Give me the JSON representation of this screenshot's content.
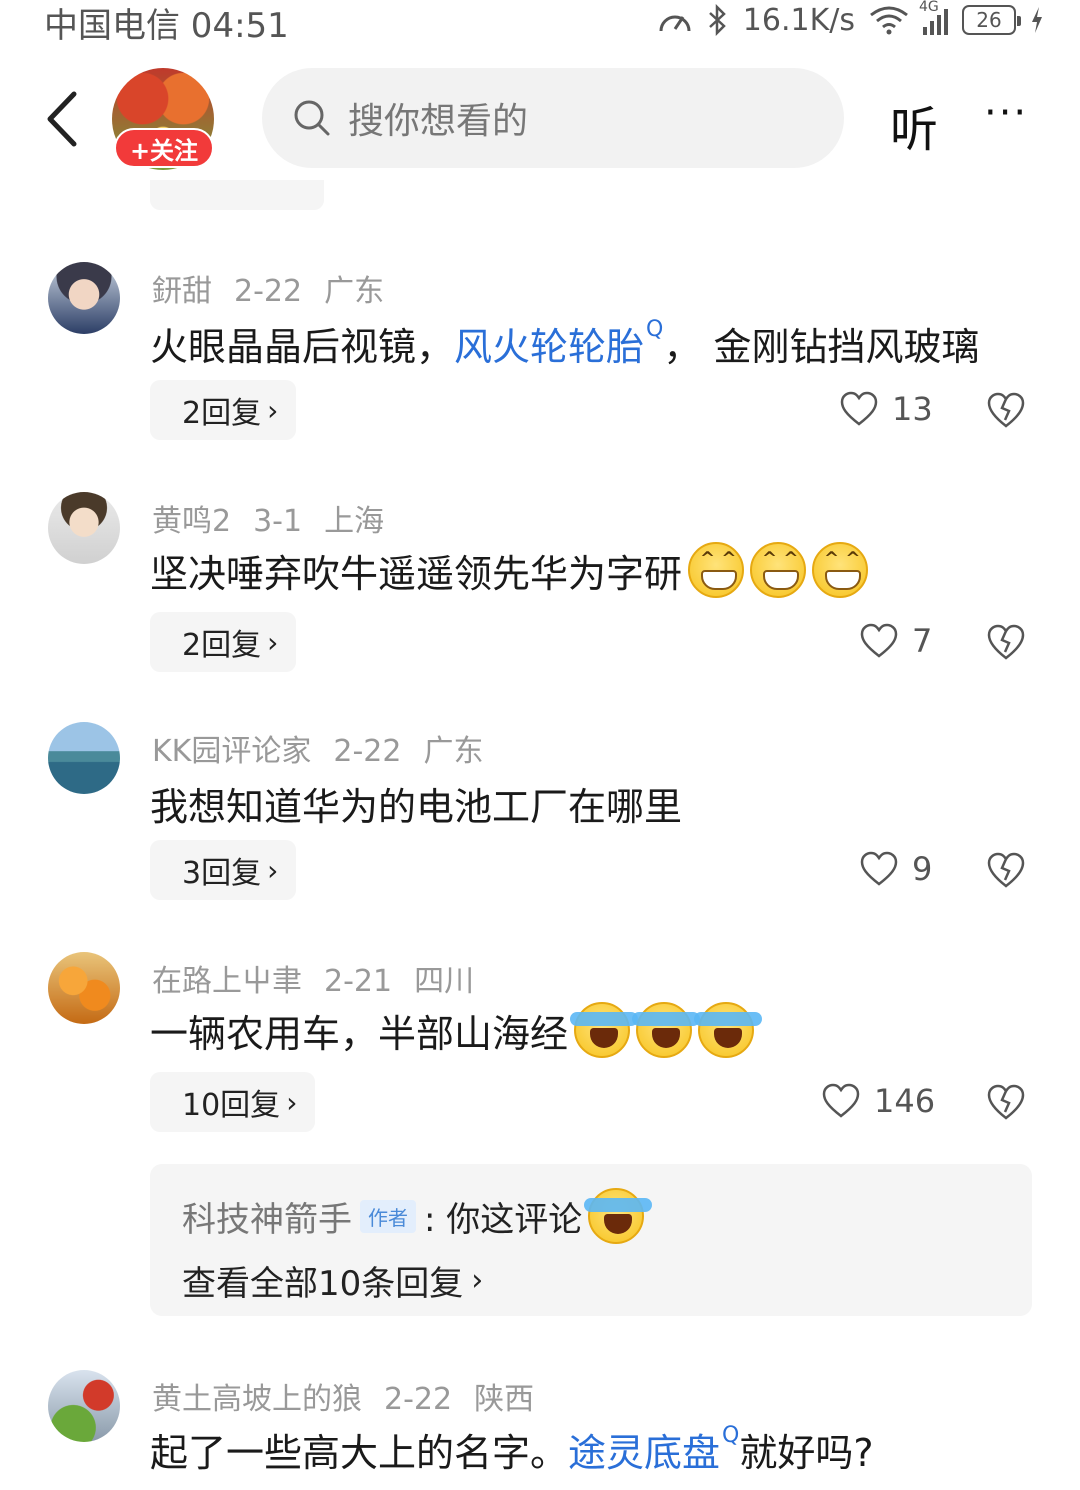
{
  "status_bar": {
    "carrier_time": "中国电信 04:51",
    "network_speed": "16.1K/s",
    "signal_label": "4G",
    "battery": "26"
  },
  "header": {
    "follow_label": "+关注",
    "search_placeholder": "搜你想看的",
    "listen_label": "听",
    "more_label": "···"
  },
  "comments": [
    {
      "user": "鈃甜",
      "date": "2-22",
      "location": "广东",
      "text_before": "火眼晶晶后视镜，",
      "link": "风火轮轮胎",
      "link_marker": "Q",
      "text_after": "， 金刚钻挡风玻璃",
      "replies": "2回复",
      "likes": "13"
    },
    {
      "user": "黄鸣2",
      "date": "3-1",
      "location": "上海",
      "text": "坚决唾弃吹牛遥遥领先华为字研",
      "emojis": [
        "grin",
        "grin",
        "grin"
      ],
      "replies": "2回复",
      "likes": "7"
    },
    {
      "user": "KK园评论家",
      "date": "2-22",
      "location": "广东",
      "text": "我想知道华为的电池工厂在哪里",
      "replies": "3回复",
      "likes": "9"
    },
    {
      "user": "在路上屮聿",
      "date": "2-21",
      "location": "四川",
      "text": "一辆农用车，半部山海经",
      "emojis": [
        "cry",
        "cry",
        "cry"
      ],
      "replies": "10回复",
      "likes": "146",
      "sub_reply": {
        "author": "科技神箭手",
        "author_tag": "作者",
        "text": ": 你这评论",
        "emojis": [
          "cry"
        ],
        "view_all": "查看全部10条回复"
      }
    },
    {
      "user": "黄土高坡上的狼",
      "date": "2-22",
      "location": "陕西",
      "text_before": "起了一些高大上的名字。",
      "link": "途灵底盘",
      "link_marker": "Q",
      "text_after": " 就好吗?"
    }
  ],
  "colors": {
    "link": "#2a6fd8",
    "follow": "#f23a3a",
    "chip_bg": "#f5f5f5"
  }
}
